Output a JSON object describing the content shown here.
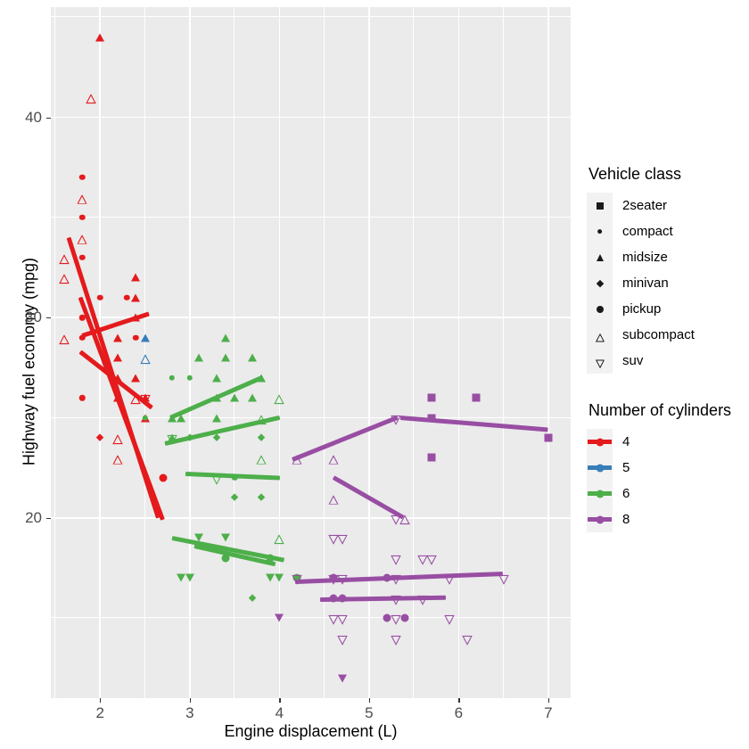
{
  "chart_data": {
    "type": "scatter",
    "title": "",
    "xlabel": "Engine displacement (L)",
    "ylabel": "Highway fuel economy (mpg)",
    "xlim": [
      1.45,
      7.25
    ],
    "ylim": [
      11.0,
      45.5
    ],
    "xticks": [
      2,
      3,
      4,
      5,
      6,
      7
    ],
    "yticks": [
      20,
      30,
      40
    ],
    "grid": true,
    "panel_bg": "#EBEBEB",
    "grid_color": "#FFFFFF",
    "shape_legend": {
      "title": "Vehicle class",
      "entries": [
        {
          "label": "2seater",
          "shape": "square-filled"
        },
        {
          "label": "compact",
          "shape": "circle-small-filled"
        },
        {
          "label": "midsize",
          "shape": "triangle-up-filled"
        },
        {
          "label": "minivan",
          "shape": "diamond-filled"
        },
        {
          "label": "pickup",
          "shape": "circle-filled"
        },
        {
          "label": "subcompact",
          "shape": "triangle-up-open"
        },
        {
          "label": "suv",
          "shape": "triangle-down-open"
        }
      ]
    },
    "color_legend": {
      "title": "Number of cylinders",
      "entries": [
        {
          "label": "4",
          "color": "#E41A1C"
        },
        {
          "label": "5",
          "color": "#377EB8"
        },
        {
          "label": "6",
          "color": "#4DAF4A"
        },
        {
          "label": "8",
          "color": "#984EA3"
        }
      ]
    },
    "points": [
      {
        "x": 2.0,
        "y": 44,
        "cyl": "4",
        "class": "midsize"
      },
      {
        "x": 1.9,
        "y": 41,
        "cyl": "4",
        "class": "subcompact"
      },
      {
        "x": 1.8,
        "y": 37,
        "cyl": "4",
        "class": "compact"
      },
      {
        "x": 1.8,
        "y": 36,
        "cyl": "4",
        "class": "subcompact"
      },
      {
        "x": 1.8,
        "y": 35,
        "cyl": "4",
        "class": "compact"
      },
      {
        "x": 1.8,
        "y": 34,
        "cyl": "4",
        "class": "subcompact"
      },
      {
        "x": 1.6,
        "y": 33,
        "cyl": "4",
        "class": "subcompact"
      },
      {
        "x": 1.8,
        "y": 33,
        "cyl": "4",
        "class": "compact"
      },
      {
        "x": 1.6,
        "y": 32,
        "cyl": "4",
        "class": "subcompact"
      },
      {
        "x": 2.4,
        "y": 32,
        "cyl": "4",
        "class": "midsize"
      },
      {
        "x": 2.0,
        "y": 31,
        "cyl": "4",
        "class": "compact"
      },
      {
        "x": 2.3,
        "y": 31,
        "cyl": "4",
        "class": "compact"
      },
      {
        "x": 2.4,
        "y": 31,
        "cyl": "4",
        "class": "midsize"
      },
      {
        "x": 1.8,
        "y": 30,
        "cyl": "4",
        "class": "compact"
      },
      {
        "x": 2.4,
        "y": 30,
        "cyl": "4",
        "class": "midsize"
      },
      {
        "x": 1.6,
        "y": 29,
        "cyl": "4",
        "class": "subcompact"
      },
      {
        "x": 1.8,
        "y": 29,
        "cyl": "4",
        "class": "compact"
      },
      {
        "x": 2.2,
        "y": 29,
        "cyl": "4",
        "class": "midsize"
      },
      {
        "x": 2.4,
        "y": 29,
        "cyl": "4",
        "class": "compact"
      },
      {
        "x": 2.5,
        "y": 29,
        "cyl": "5",
        "class": "midsize"
      },
      {
        "x": 2.2,
        "y": 28,
        "cyl": "4",
        "class": "midsize"
      },
      {
        "x": 2.5,
        "y": 28,
        "cyl": "5",
        "class": "subcompact"
      },
      {
        "x": 2.2,
        "y": 27,
        "cyl": "4",
        "class": "midsize"
      },
      {
        "x": 2.4,
        "y": 27,
        "cyl": "4",
        "class": "midsize"
      },
      {
        "x": 2.5,
        "y": 26,
        "cyl": "4",
        "class": "midsize"
      },
      {
        "x": 2.5,
        "y": 26,
        "cyl": "4",
        "class": "suv"
      },
      {
        "x": 1.8,
        "y": 26,
        "cyl": "4",
        "class": "compact"
      },
      {
        "x": 2.2,
        "y": 26,
        "cyl": "4",
        "class": "midsize"
      },
      {
        "x": 2.4,
        "y": 26,
        "cyl": "4",
        "class": "subcompact"
      },
      {
        "x": 2.5,
        "y": 25,
        "cyl": "4",
        "class": "midsize"
      },
      {
        "x": 2.5,
        "y": 25,
        "cyl": "6",
        "class": "compact"
      },
      {
        "x": 2.0,
        "y": 24,
        "cyl": "4",
        "class": "minivan"
      },
      {
        "x": 2.2,
        "y": 24,
        "cyl": "4",
        "class": "subcompact"
      },
      {
        "x": 2.2,
        "y": 23,
        "cyl": "4",
        "class": "subcompact"
      },
      {
        "x": 2.7,
        "y": 22,
        "cyl": "4",
        "class": "pickup"
      },
      {
        "x": 3.4,
        "y": 29,
        "cyl": "6",
        "class": "midsize"
      },
      {
        "x": 3.1,
        "y": 28,
        "cyl": "6",
        "class": "midsize"
      },
      {
        "x": 3.4,
        "y": 28,
        "cyl": "6",
        "class": "midsize"
      },
      {
        "x": 3.7,
        "y": 28,
        "cyl": "6",
        "class": "midsize"
      },
      {
        "x": 2.8,
        "y": 27,
        "cyl": "6",
        "class": "compact"
      },
      {
        "x": 3.0,
        "y": 27,
        "cyl": "6",
        "class": "compact"
      },
      {
        "x": 3.3,
        "y": 27,
        "cyl": "6",
        "class": "midsize"
      },
      {
        "x": 3.8,
        "y": 27,
        "cyl": "6",
        "class": "midsize"
      },
      {
        "x": 3.3,
        "y": 26,
        "cyl": "6",
        "class": "midsize"
      },
      {
        "x": 3.5,
        "y": 26,
        "cyl": "6",
        "class": "midsize"
      },
      {
        "x": 3.7,
        "y": 26,
        "cyl": "6",
        "class": "midsize"
      },
      {
        "x": 4.0,
        "y": 26,
        "cyl": "6",
        "class": "subcompact"
      },
      {
        "x": 2.8,
        "y": 25,
        "cyl": "6",
        "class": "midsize"
      },
      {
        "x": 2.9,
        "y": 25,
        "cyl": "6",
        "class": "midsize"
      },
      {
        "x": 3.3,
        "y": 25,
        "cyl": "6",
        "class": "midsize"
      },
      {
        "x": 3.8,
        "y": 25,
        "cyl": "6",
        "class": "subcompact"
      },
      {
        "x": 2.8,
        "y": 24,
        "cyl": "6",
        "class": "midsize"
      },
      {
        "x": 2.8,
        "y": 24,
        "cyl": "6",
        "class": "suv"
      },
      {
        "x": 3.0,
        "y": 24,
        "cyl": "6",
        "class": "minivan"
      },
      {
        "x": 3.3,
        "y": 24,
        "cyl": "6",
        "class": "minivan"
      },
      {
        "x": 3.8,
        "y": 24,
        "cyl": "6",
        "class": "minivan"
      },
      {
        "x": 3.8,
        "y": 23,
        "cyl": "6",
        "class": "subcompact"
      },
      {
        "x": 3.3,
        "y": 22,
        "cyl": "6",
        "class": "suv"
      },
      {
        "x": 3.5,
        "y": 22,
        "cyl": "6",
        "class": "compact"
      },
      {
        "x": 3.5,
        "y": 21,
        "cyl": "6",
        "class": "minivan"
      },
      {
        "x": 3.8,
        "y": 21,
        "cyl": "6",
        "class": "minivan"
      },
      {
        "x": 3.1,
        "y": 19,
        "cyl": "6",
        "class": "suv"
      },
      {
        "x": 3.4,
        "y": 19,
        "cyl": "6",
        "class": "suv"
      },
      {
        "x": 4.0,
        "y": 19,
        "cyl": "6",
        "class": "subcompact"
      },
      {
        "x": 3.4,
        "y": 18,
        "cyl": "6",
        "class": "pickup"
      },
      {
        "x": 3.9,
        "y": 18,
        "cyl": "6",
        "class": "pickup"
      },
      {
        "x": 2.9,
        "y": 17,
        "cyl": "6",
        "class": "suv"
      },
      {
        "x": 3.0,
        "y": 17,
        "cyl": "6",
        "class": "suv"
      },
      {
        "x": 3.9,
        "y": 17,
        "cyl": "6",
        "class": "suv"
      },
      {
        "x": 4.0,
        "y": 17,
        "cyl": "6",
        "class": "suv"
      },
      {
        "x": 4.2,
        "y": 17,
        "cyl": "6",
        "class": "pickup"
      },
      {
        "x": 3.7,
        "y": 16,
        "cyl": "6",
        "class": "minivan"
      },
      {
        "x": 5.7,
        "y": 26,
        "cyl": "8",
        "class": "2seater"
      },
      {
        "x": 6.2,
        "y": 26,
        "cyl": "8",
        "class": "2seater"
      },
      {
        "x": 5.7,
        "y": 25,
        "cyl": "8",
        "class": "2seater"
      },
      {
        "x": 7.0,
        "y": 24,
        "cyl": "8",
        "class": "2seater"
      },
      {
        "x": 5.3,
        "y": 25,
        "cyl": "8",
        "class": "suv"
      },
      {
        "x": 5.7,
        "y": 23,
        "cyl": "8",
        "class": "2seater"
      },
      {
        "x": 4.2,
        "y": 23,
        "cyl": "8",
        "class": "subcompact"
      },
      {
        "x": 4.6,
        "y": 23,
        "cyl": "8",
        "class": "subcompact"
      },
      {
        "x": 4.6,
        "y": 21,
        "cyl": "8",
        "class": "subcompact"
      },
      {
        "x": 5.3,
        "y": 20,
        "cyl": "8",
        "class": "suv"
      },
      {
        "x": 5.4,
        "y": 20,
        "cyl": "8",
        "class": "subcompact"
      },
      {
        "x": 4.6,
        "y": 19,
        "cyl": "8",
        "class": "suv"
      },
      {
        "x": 4.7,
        "y": 19,
        "cyl": "8",
        "class": "suv"
      },
      {
        "x": 5.3,
        "y": 18,
        "cyl": "8",
        "class": "suv"
      },
      {
        "x": 5.6,
        "y": 18,
        "cyl": "8",
        "class": "suv"
      },
      {
        "x": 5.7,
        "y": 18,
        "cyl": "8",
        "class": "suv"
      },
      {
        "x": 4.2,
        "y": 17,
        "cyl": "8",
        "class": "suv"
      },
      {
        "x": 4.6,
        "y": 17,
        "cyl": "8",
        "class": "suv"
      },
      {
        "x": 4.6,
        "y": 17,
        "cyl": "8",
        "class": "pickup"
      },
      {
        "x": 4.7,
        "y": 17,
        "cyl": "8",
        "class": "suv"
      },
      {
        "x": 5.2,
        "y": 17,
        "cyl": "8",
        "class": "pickup"
      },
      {
        "x": 5.3,
        "y": 17,
        "cyl": "8",
        "class": "suv"
      },
      {
        "x": 5.9,
        "y": 17,
        "cyl": "8",
        "class": "suv"
      },
      {
        "x": 6.5,
        "y": 17,
        "cyl": "8",
        "class": "suv"
      },
      {
        "x": 4.6,
        "y": 16,
        "cyl": "8",
        "class": "pickup"
      },
      {
        "x": 4.7,
        "y": 16,
        "cyl": "8",
        "class": "pickup"
      },
      {
        "x": 5.3,
        "y": 16,
        "cyl": "8",
        "class": "suv"
      },
      {
        "x": 5.6,
        "y": 16,
        "cyl": "8",
        "class": "suv"
      },
      {
        "x": 4.6,
        "y": 15,
        "cyl": "8",
        "class": "suv"
      },
      {
        "x": 4.7,
        "y": 15,
        "cyl": "8",
        "class": "suv"
      },
      {
        "x": 5.2,
        "y": 15,
        "cyl": "8",
        "class": "pickup"
      },
      {
        "x": 5.3,
        "y": 15,
        "cyl": "8",
        "class": "suv"
      },
      {
        "x": 5.4,
        "y": 15,
        "cyl": "8",
        "class": "pickup"
      },
      {
        "x": 4.0,
        "y": 15,
        "cyl": "8",
        "class": "suv"
      },
      {
        "x": 5.9,
        "y": 15,
        "cyl": "8",
        "class": "suv"
      },
      {
        "x": 5.3,
        "y": 14,
        "cyl": "8",
        "class": "suv"
      },
      {
        "x": 4.7,
        "y": 14,
        "cyl": "8",
        "class": "suv"
      },
      {
        "x": 6.1,
        "y": 14,
        "cyl": "8",
        "class": "suv"
      },
      {
        "x": 4.7,
        "y": 12,
        "cyl": "8",
        "class": "suv"
      }
    ],
    "smooth_lines": [
      {
        "cyl": "4",
        "x1": 1.65,
        "y1": 34.0,
        "x2": 2.65,
        "y2": 20.0
      },
      {
        "cyl": "4",
        "x1": 1.78,
        "y1": 31.0,
        "x2": 2.7,
        "y2": 19.9
      },
      {
        "cyl": "4",
        "x1": 1.8,
        "y1": 29.1,
        "x2": 2.55,
        "y2": 30.2
      },
      {
        "cyl": "4",
        "x1": 1.78,
        "y1": 28.3,
        "x2": 2.58,
        "y2": 25.5
      },
      {
        "cyl": "6",
        "x1": 2.78,
        "y1": 25.0,
        "x2": 3.8,
        "y2": 27.0
      },
      {
        "cyl": "6",
        "x1": 2.72,
        "y1": 23.7,
        "x2": 4.0,
        "y2": 25.0
      },
      {
        "cyl": "6",
        "x1": 2.95,
        "y1": 22.2,
        "x2": 4.0,
        "y2": 22.0
      },
      {
        "cyl": "6",
        "x1": 2.8,
        "y1": 19.0,
        "x2": 4.05,
        "y2": 17.9
      },
      {
        "cyl": "6",
        "x1": 3.05,
        "y1": 18.6,
        "x2": 3.95,
        "y2": 17.7
      },
      {
        "cyl": "8",
        "x1": 4.15,
        "y1": 22.9,
        "x2": 5.32,
        "y2": 25.0
      },
      {
        "cyl": "8",
        "x1": 4.6,
        "y1": 22.0,
        "x2": 5.38,
        "y2": 20.0
      },
      {
        "cyl": "8",
        "x1": 5.35,
        "y1": 25.0,
        "x2": 7.0,
        "y2": 24.4
      },
      {
        "cyl": "8",
        "x1": 4.18,
        "y1": 16.8,
        "x2": 6.5,
        "y2": 17.2
      },
      {
        "cyl": "8",
        "x1": 4.45,
        "y1": 15.9,
        "x2": 5.85,
        "y2": 16.0
      }
    ]
  }
}
